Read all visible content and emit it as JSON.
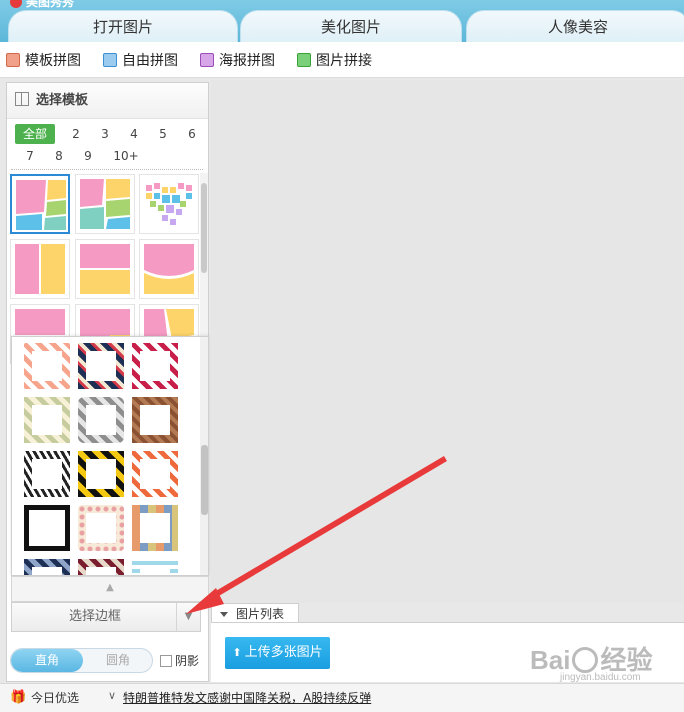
{
  "header": {
    "app_title": "美图秀秀",
    "tabs": [
      "打开图片",
      "美化图片",
      "人像美容"
    ]
  },
  "toolbar": {
    "items": [
      "模板拼图",
      "自由拼图",
      "海报拼图",
      "图片拼接"
    ]
  },
  "left_panel": {
    "title": "选择模板",
    "filters_row1": [
      "全部",
      "2",
      "3",
      "4",
      "5",
      "6"
    ],
    "filters_row2": [
      "7",
      "8",
      "9",
      "10+"
    ],
    "active_filter": "全部"
  },
  "frame_selector": {
    "label": "选择边框",
    "collapse_symbol": "▲",
    "dropdown_symbol": "▼"
  },
  "corner_toggle": {
    "options": [
      "直角",
      "圆角"
    ],
    "selected": "直角"
  },
  "shadow_checkbox": {
    "label": "阴影",
    "checked": false
  },
  "picture_list": {
    "tab_label": "图片列表",
    "upload_button": "上传多张图片"
  },
  "watermark": {
    "text_left": "Bai",
    "text_right": "经验",
    "sub": "jingyan.baidu.com"
  },
  "newsbar": {
    "gift_icon": "gift-icon",
    "label": "今日优选",
    "headline": "特朗普推特发文感谢中国降关税，A股持续反弹"
  },
  "colors": {
    "header_blue": "#5db7d9",
    "accent_green": "#4db24d",
    "upload_blue": "#1a9ee0",
    "annotation_red": "#e83a3a"
  }
}
